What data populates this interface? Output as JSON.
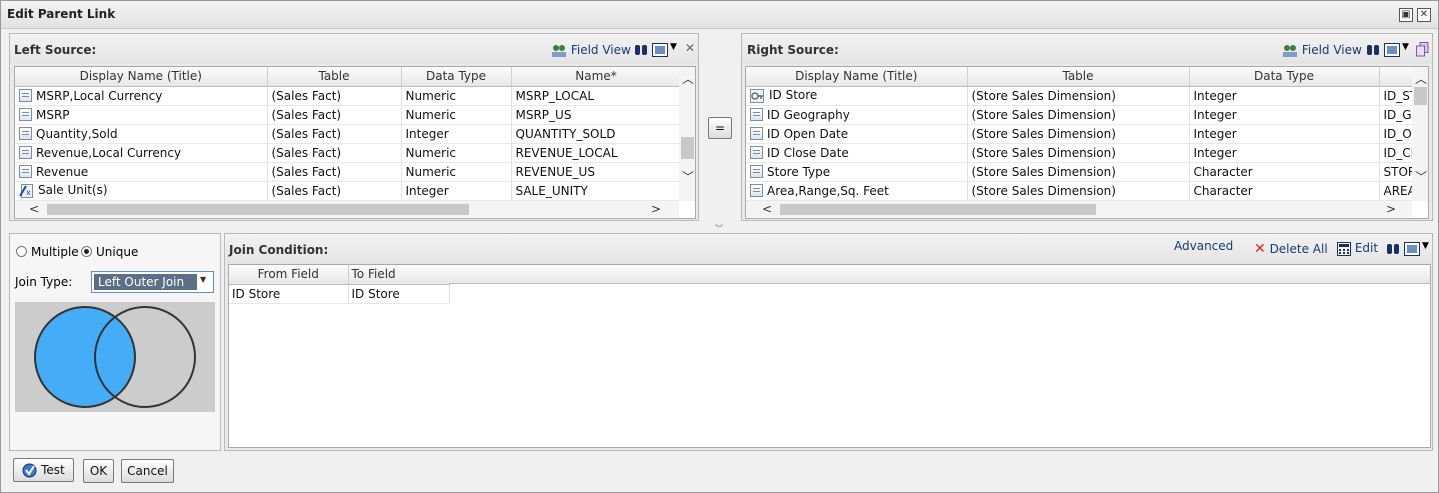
{
  "dialog": {
    "title": "Edit Parent Link"
  },
  "left": {
    "title": "Left Source:",
    "field_view": "Field View",
    "columns": [
      "Display Name (Title)",
      "Table",
      "Data Type",
      "Name*"
    ],
    "rows": [
      {
        "icon": "field-icon",
        "name": "MSRP,Local Currency",
        "table": "(Sales Fact)",
        "type": "Numeric",
        "field": "MSRP_LOCAL"
      },
      {
        "icon": "field-icon",
        "name": "MSRP",
        "table": "(Sales Fact)",
        "type": "Numeric",
        "field": "MSRP_US"
      },
      {
        "icon": "field-icon",
        "name": "Quantity,Sold",
        "table": "(Sales Fact)",
        "type": "Integer",
        "field": "QUANTITY_SOLD"
      },
      {
        "icon": "field-icon",
        "name": "Revenue,Local Currency",
        "table": "(Sales Fact)",
        "type": "Numeric",
        "field": "REVENUE_LOCAL"
      },
      {
        "icon": "field-icon",
        "name": "Revenue",
        "table": "(Sales Fact)",
        "type": "Numeric",
        "field": "REVENUE_US"
      },
      {
        "icon": "computed-field-icon",
        "name": "Sale Unit(s)",
        "table": "(Sales Fact)",
        "type": "Integer",
        "field": "SALE_UNITY"
      }
    ]
  },
  "equals_label": "=",
  "right": {
    "title": "Right Source:",
    "field_view": "Field View",
    "columns": [
      "Display Name (Title)",
      "Table",
      "Data Type",
      ""
    ],
    "rows": [
      {
        "icon": "key-field-icon",
        "name": "ID Store",
        "table": "(Store Sales Dimension)",
        "type": "Integer",
        "field": "ID_ST"
      },
      {
        "icon": "field-icon",
        "name": "ID Geography",
        "table": "(Store Sales Dimension)",
        "type": "Integer",
        "field": "ID_GI"
      },
      {
        "icon": "field-icon",
        "name": "ID Open Date",
        "table": "(Store Sales Dimension)",
        "type": "Integer",
        "field": "ID_OI"
      },
      {
        "icon": "field-icon",
        "name": "ID Close Date",
        "table": "(Store Sales Dimension)",
        "type": "Integer",
        "field": "ID_CI"
      },
      {
        "icon": "field-icon",
        "name": "Store Type",
        "table": "(Store Sales Dimension)",
        "type": "Character",
        "field": "STOR"
      },
      {
        "icon": "field-icon",
        "name": "Area,Range,Sq. Feet",
        "table": "(Store Sales Dimension)",
        "type": "Character",
        "field": "AREA"
      }
    ]
  },
  "options": {
    "multiple_label": "Multiple",
    "unique_label": "Unique",
    "selected": "Unique",
    "join_type_label": "Join Type:",
    "join_type_value": "Left Outer Join"
  },
  "join": {
    "title": "Join Condition:",
    "advanced": "Advanced",
    "delete_all": "Delete All",
    "edit": "Edit",
    "columns": [
      "From Field",
      "To Field"
    ],
    "rows": [
      {
        "from": "ID Store",
        "to": "ID Store"
      }
    ]
  },
  "footer": {
    "test": "Test",
    "ok": "OK",
    "cancel": "Cancel"
  },
  "colors": {
    "venn_fill": "#45adf7",
    "venn_bg": "#cccccc",
    "accent_text": "#1a3a70",
    "delete_red": "#d9261c"
  }
}
